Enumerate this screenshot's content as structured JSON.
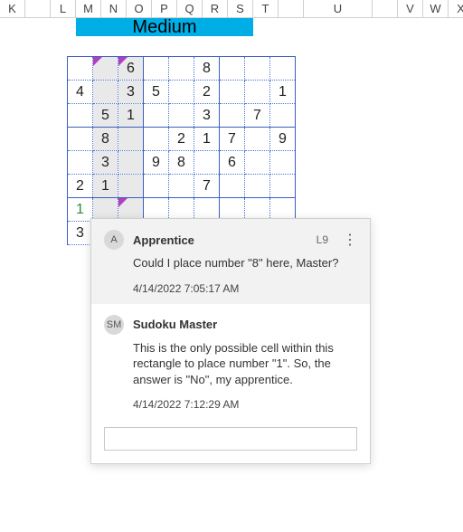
{
  "columns": [
    {
      "label": "K",
      "w": "narrow"
    },
    {
      "label": "",
      "w": "narrow"
    },
    {
      "label": "L",
      "w": "narrow"
    },
    {
      "label": "M",
      "w": "narrow"
    },
    {
      "label": "N",
      "w": "narrow"
    },
    {
      "label": "O",
      "w": "narrow"
    },
    {
      "label": "P",
      "w": "narrow"
    },
    {
      "label": "Q",
      "w": "narrow"
    },
    {
      "label": "R",
      "w": "narrow"
    },
    {
      "label": "S",
      "w": "narrow"
    },
    {
      "label": "T",
      "w": "narrow"
    },
    {
      "label": "",
      "w": "narrow"
    },
    {
      "label": "U",
      "w": "wide"
    },
    {
      "label": "",
      "w": "narrow"
    },
    {
      "label": "V",
      "w": "narrow"
    },
    {
      "label": "W",
      "w": "narrow"
    },
    {
      "label": "X",
      "w": "narrow"
    }
  ],
  "difficulty": "Medium",
  "sudoku": {
    "shaded_cols": [
      1,
      2
    ],
    "marks": [
      [
        0,
        1
      ],
      [
        0,
        2
      ],
      [
        6,
        2
      ]
    ],
    "green_cells": [
      [
        6,
        0
      ],
      [
        6,
        1
      ]
    ],
    "grid": [
      [
        "",
        "",
        "6",
        "",
        "",
        "8",
        "",
        "",
        ""
      ],
      [
        "4",
        "",
        "3",
        "5",
        "",
        "2",
        "",
        "",
        "1"
      ],
      [
        "",
        "5",
        "1",
        "",
        "",
        "3",
        "",
        "7",
        ""
      ],
      [
        "",
        "8",
        "",
        "",
        "2",
        "1",
        "7",
        "",
        "9"
      ],
      [
        "",
        "3",
        "",
        "9",
        "8",
        "",
        "6",
        "",
        ""
      ],
      [
        "2",
        "1",
        "",
        "",
        "",
        "7",
        "",
        "",
        ""
      ],
      [
        "1",
        "",
        "",
        "",
        "",
        "",
        "",
        "",
        ""
      ],
      [
        "3",
        "",
        "",
        "",
        "",
        "",
        "",
        "",
        ""
      ],
      [
        "",
        "",
        "",
        "",
        "",
        "",
        "",
        "",
        ""
      ]
    ],
    "visible_rows": 8
  },
  "comments": [
    {
      "avatar": "A",
      "author": "Apprentice",
      "cell_ref": "L9",
      "show_ref": true,
      "body": "Could I place number \"8\" here, Master?",
      "time": "4/14/2022 7:05:17 AM",
      "active": true
    },
    {
      "avatar": "SM",
      "author": "Sudoku Master",
      "cell_ref": "",
      "show_ref": false,
      "body": "This is the only possible cell within this rectangle to place number \"1\". So, the answer is \"No\", my apprentice.",
      "time": "4/14/2022 7:12:29 AM",
      "active": false
    }
  ],
  "reply_placeholder": ""
}
